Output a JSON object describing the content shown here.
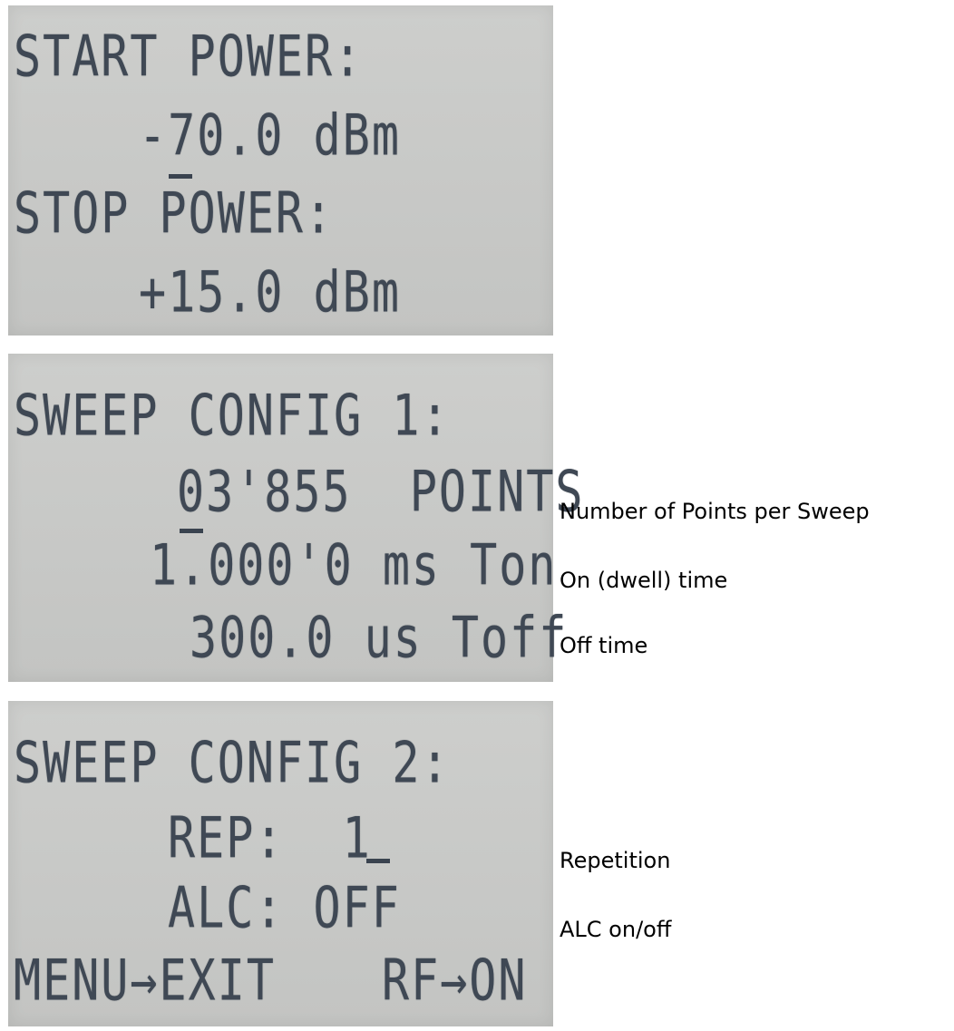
{
  "panels": {
    "power": {
      "start_label": "START POWER:",
      "start_value": "-70.0 dBm",
      "stop_label": "STOP POWER:",
      "stop_value": "+15.0 dBm"
    },
    "sweep1": {
      "title": "SWEEP CONFIG 1:",
      "points": "03'855  POINTS",
      "ton": "1.000'0 ms Ton",
      "toff": "300.0 us Toff"
    },
    "sweep2": {
      "title": "SWEEP CONFIG 2:",
      "rep": "REP:  1",
      "alc": "ALC: OFF",
      "menu": "MENU→EXIT",
      "rf": "RF→ON"
    }
  },
  "annotations": {
    "points": "Number of Points per Sweep",
    "ton": "On (dwell) time",
    "toff": "Off time",
    "rep": "Repetition",
    "alc": "ALC on/off"
  },
  "colors": {
    "lcd_background": "#c8c9c7",
    "lcd_text": "#3f4854"
  }
}
